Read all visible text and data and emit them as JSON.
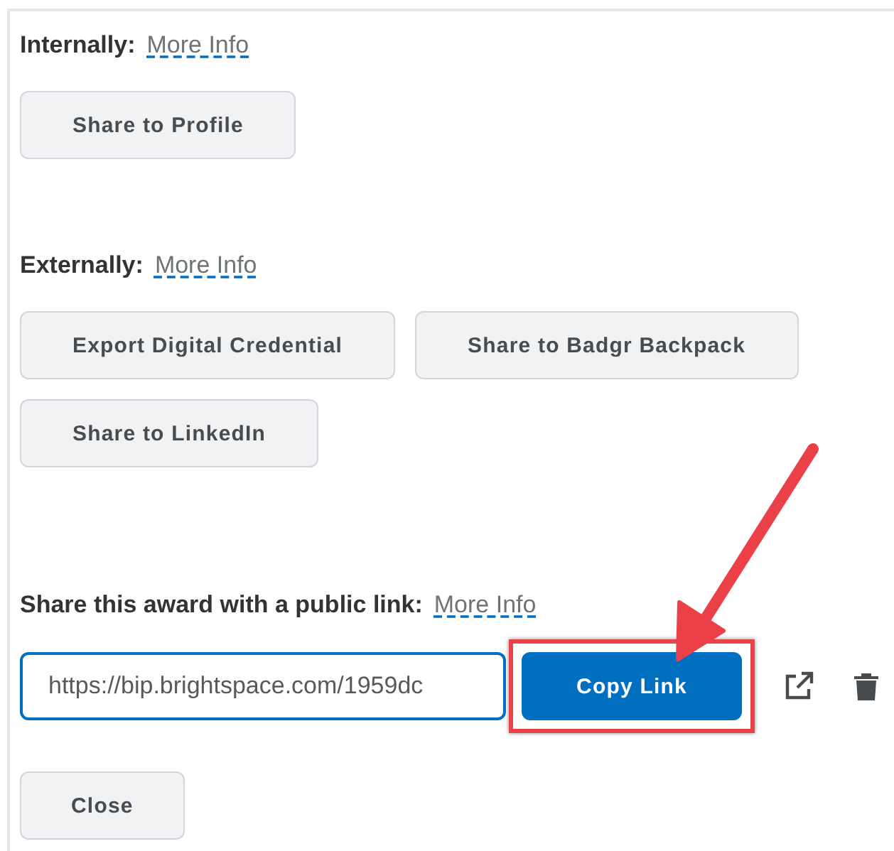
{
  "sections": [
    {
      "label": "Internally:",
      "link": "More Info",
      "buttons": [
        "Share to Profile"
      ]
    },
    {
      "label": "Externally:",
      "link": "More Info",
      "buttons": [
        "Export Digital Credential",
        "Share to Badgr Backpack",
        "Share to LinkedIn"
      ]
    }
  ],
  "public_link": {
    "label": "Share this award with a public link:",
    "link": "More Info",
    "value": "https://bip.brightspace.com/1959dc",
    "copy_button": "Copy Link"
  },
  "close_button": "Close"
}
